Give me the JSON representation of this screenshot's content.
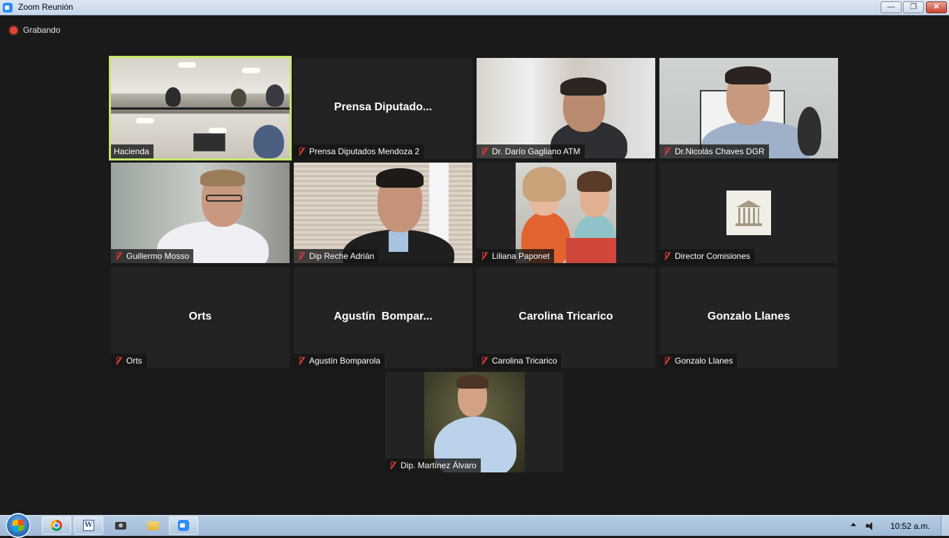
{
  "window": {
    "title": "Zoom Reunión"
  },
  "recording": {
    "label": "Grabando"
  },
  "participants": [
    {
      "label": "Hacienda",
      "muted": false,
      "video": true
    },
    {
      "label": "Prensa Diputados Mendoza 2",
      "display_name": "Prensa Diputado...",
      "muted": true,
      "video": false
    },
    {
      "label": "Dr. Darío Gagliano ATM",
      "muted": true,
      "video": true
    },
    {
      "label": "Dr.Nicolás Chaves DGR",
      "muted": true,
      "video": true
    },
    {
      "label": "Guillermo Mosso",
      "muted": true,
      "video": true
    },
    {
      "label": "Dip Reche Adrián",
      "muted": true,
      "video": true
    },
    {
      "label": "Liliana Paponet",
      "muted": true,
      "video": true
    },
    {
      "label": "Director Comisiones",
      "muted": true,
      "video": true
    },
    {
      "label": "Orts",
      "display_name": "Orts",
      "muted": true,
      "video": false
    },
    {
      "label": "Agustín Bomparola",
      "display_name": "Agustín  Bompar...",
      "muted": true,
      "video": false
    },
    {
      "label": "Carolina Tricarico",
      "display_name": "Carolina Tricarico",
      "muted": true,
      "video": false
    },
    {
      "label": "Gonzalo Llanes",
      "display_name": "Gonzalo Llanes",
      "muted": true,
      "video": false
    },
    {
      "label": "Dip. Martínez Álvaro",
      "muted": true,
      "video": true
    }
  ],
  "active_speaker_color": "#c7e96a",
  "mute_icon_color": "#e03b3b",
  "taskbar": {
    "icons": [
      "start-orb-icon",
      "chrome-icon",
      "word-icon",
      "camera-icon",
      "folder-icon",
      "zoom-icon"
    ],
    "clock": "10:52 a.m."
  }
}
